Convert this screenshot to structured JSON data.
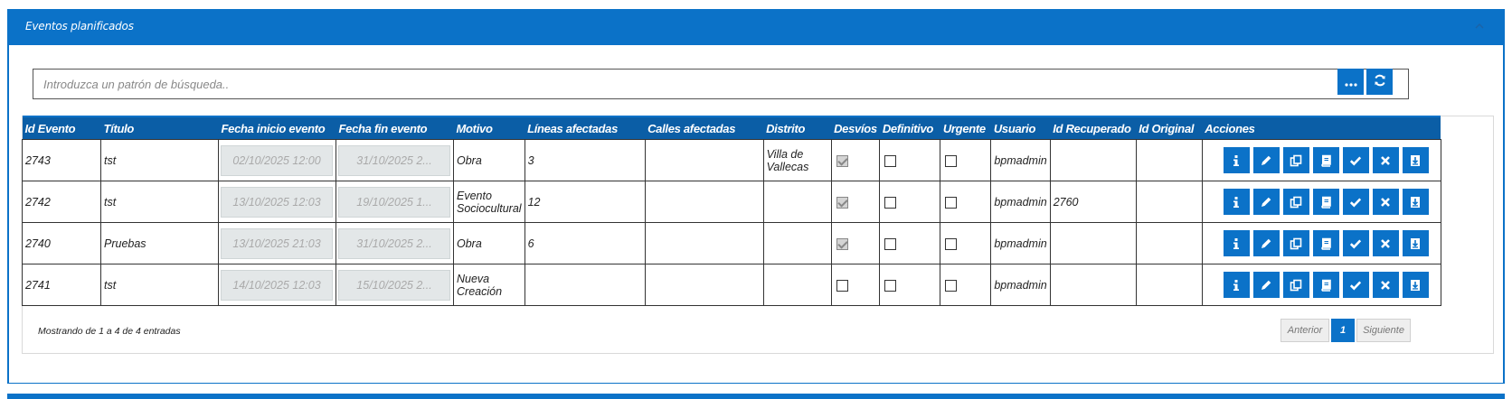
{
  "panel": {
    "title": "Eventos planificados",
    "collapse_icon": "chevron-up-icon"
  },
  "search": {
    "placeholder": "Introduzca un patrón de búsqueda..",
    "value": ""
  },
  "toolbar": {
    "more_icon": "ellipsis-icon",
    "refresh_icon": "refresh-icon"
  },
  "table": {
    "columns": [
      "Id Evento",
      "Título",
      "Fecha inicio evento",
      "Fecha fin evento",
      "Motivo",
      "Líneas afectadas",
      "Calles afectadas",
      "Distrito",
      "Desvíos",
      "Definitivo",
      "Urgente",
      "Usuario",
      "Id Recuperado",
      "Id Original",
      "Acciones"
    ],
    "rows": [
      {
        "id": "2743",
        "titulo": "tst",
        "inicio": "02/10/2025 12:00",
        "fin": "31/10/2025 2...",
        "motivo": "Obra",
        "lineas": "3",
        "calles": "",
        "distrito": "Villa de Vallecas",
        "desvios": true,
        "definitivo": false,
        "urgente": false,
        "usuario": "bpmadmin",
        "recuperado": "",
        "original": ""
      },
      {
        "id": "2742",
        "titulo": "tst",
        "inicio": "13/10/2025 12:03",
        "fin": "19/10/2025 1...",
        "motivo": "Evento Sociocultural",
        "lineas": "12",
        "calles": "",
        "distrito": "",
        "desvios": true,
        "definitivo": false,
        "urgente": false,
        "usuario": "bpmadmin",
        "recuperado": "2760",
        "original": ""
      },
      {
        "id": "2740",
        "titulo": "Pruebas",
        "inicio": "13/10/2025 21:03",
        "fin": "31/10/2025 2...",
        "motivo": "Obra",
        "lineas": "6",
        "calles": "",
        "distrito": "",
        "desvios": true,
        "definitivo": false,
        "urgente": false,
        "usuario": "bpmadmin",
        "recuperado": "",
        "original": ""
      },
      {
        "id": "2741",
        "titulo": "tst",
        "inicio": "14/10/2025 12:03",
        "fin": "15/10/2025 2...",
        "motivo": "Nueva Creación",
        "lineas": "",
        "calles": "",
        "distrito": "",
        "desvios": false,
        "definitivo": false,
        "urgente": false,
        "usuario": "bpmadmin",
        "recuperado": "",
        "original": ""
      }
    ],
    "action_icons": [
      "info-icon",
      "edit-icon",
      "copy-icon",
      "book-icon",
      "check-icon",
      "close-icon",
      "download-icon"
    ]
  },
  "footer": {
    "info": "Mostrando de 1 a 4 de 4 entradas"
  },
  "pagination": {
    "prev": "Anterior",
    "current": "1",
    "next": "Siguiente"
  },
  "colors": {
    "primary": "#0b72c8",
    "header": "#0b5ea6"
  }
}
